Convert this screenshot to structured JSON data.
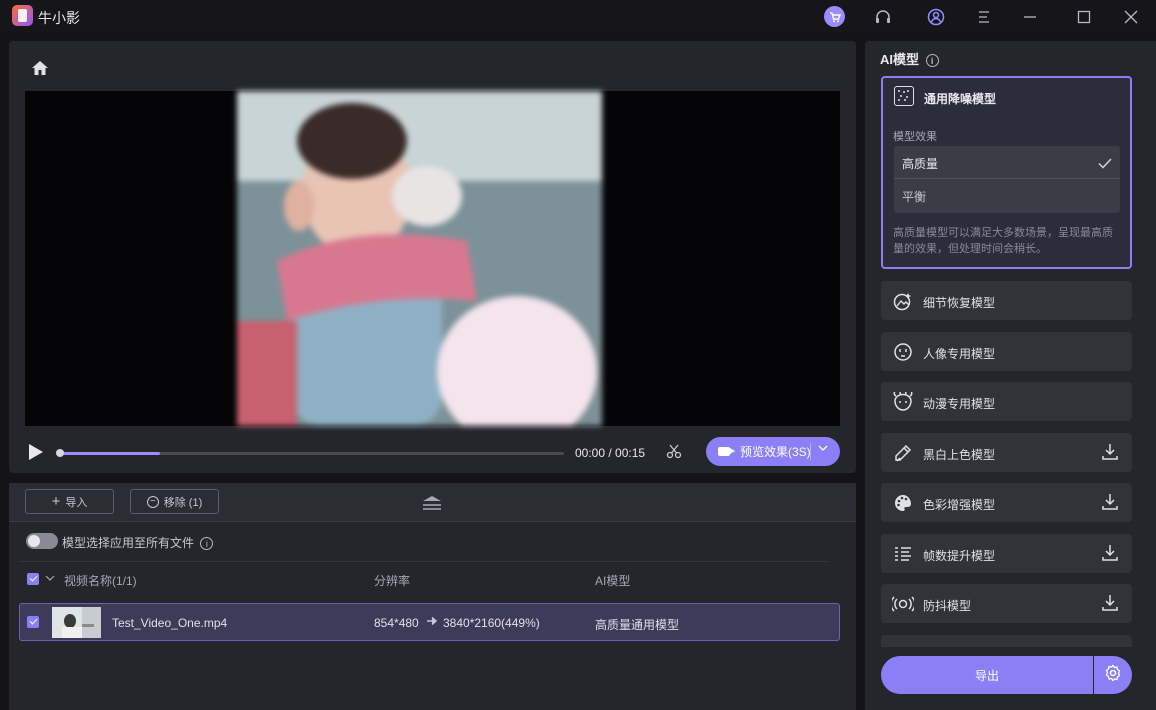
{
  "app": {
    "title": "牛小影"
  },
  "player": {
    "time": "00:00 / 00:15",
    "preview_label": "预览效果(3S)",
    "progress": 0.2
  },
  "files": {
    "import_label": "导入",
    "remove_label": "移除 (1)",
    "apply_all_label": "模型选择应用至所有文件",
    "columns": {
      "name": "视频名称(1/1)",
      "resolution": "分辨率",
      "model": "AI模型"
    },
    "rows": [
      {
        "name": "Test_Video_One.mp4",
        "res_from": "854*480",
        "res_to": "3840*2160(449%)",
        "model": "高质量通用模型"
      }
    ]
  },
  "sidebar": {
    "title": "AI模型",
    "active_model": {
      "name": "通用降噪模型",
      "effect_label": "模型效果",
      "options": [
        "高质量",
        "平衡"
      ],
      "selected": "高质量",
      "description": "高质量模型可以满足大多数场景，呈现最高质量的效果，但处理时间会稍长。"
    },
    "models": [
      {
        "name": "细节恢复模型",
        "icon": "detail-icon",
        "download": false
      },
      {
        "name": "人像专用模型",
        "icon": "portrait-icon",
        "download": false
      },
      {
        "name": "动漫专用模型",
        "icon": "anime-icon",
        "download": false
      },
      {
        "name": "黑白上色模型",
        "icon": "colorize-icon",
        "download": true
      },
      {
        "name": "色彩增强模型",
        "icon": "palette-icon",
        "download": true
      },
      {
        "name": "帧数提升模型",
        "icon": "frames-icon",
        "download": true
      },
      {
        "name": "防抖模型",
        "icon": "stabilize-icon",
        "download": true
      }
    ],
    "export_label": "导出"
  },
  "colors": {
    "accent": "#8b7ff5",
    "bg": "#141418",
    "panel": "#25252c"
  }
}
